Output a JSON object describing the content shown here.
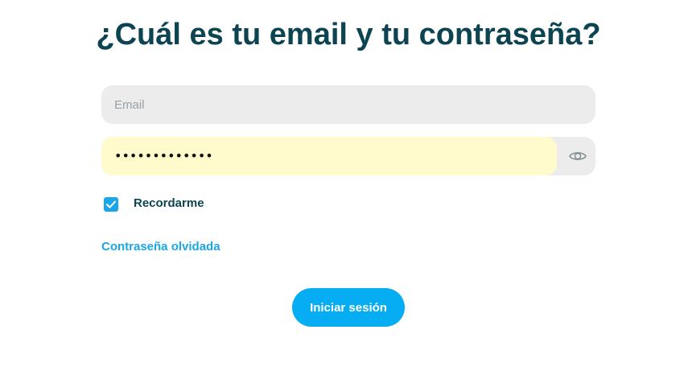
{
  "page": {
    "title": "¿Cuál es tu email y tu contraseña?"
  },
  "form": {
    "email": {
      "placeholder": "Email",
      "value": ""
    },
    "password": {
      "masked_value": "•••••••••••••",
      "toggle_icon": "eye-icon"
    },
    "remember": {
      "label": "Recordarme",
      "checked": true
    },
    "forgot_link": "Contraseña olvidada",
    "submit_label": "Iniciar sesión"
  },
  "colors": {
    "title": "#0d4451",
    "accent": "#07adf2",
    "input_bg": "#ececec",
    "autofill_bg": "#fffbcc"
  }
}
